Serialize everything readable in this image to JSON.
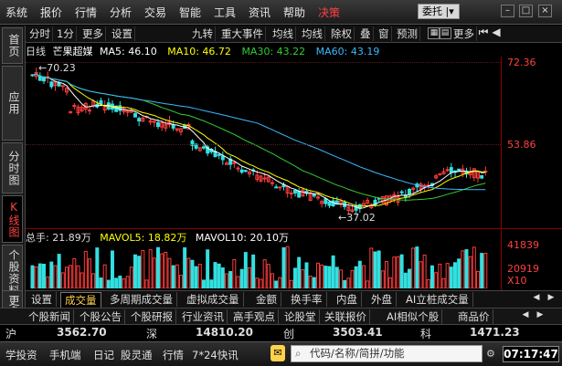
{
  "menu": {
    "items": [
      "系统",
      "报价",
      "行情",
      "分析",
      "交易",
      "智能",
      "工具",
      "资讯",
      "帮助",
      "决策"
    ],
    "active_index": 9,
    "delegate_label": "委托",
    "window_buttons": [
      "–",
      "□",
      "×"
    ]
  },
  "left_tabs": [
    "首页",
    "应用",
    "分时图",
    "K线图",
    "个股资料",
    "更多"
  ],
  "toolbar": {
    "left": [
      "分时",
      "1分",
      "更多",
      "设置"
    ],
    "right": [
      "九转",
      "重大事件",
      "均线",
      "均线",
      "除权",
      "叠",
      "窗",
      "预测",
      "更多"
    ]
  },
  "ma": {
    "period": "日线",
    "stock": "芒果超媒",
    "ma5": "MA5: 46.10",
    "ma10": "MA10: 46.72",
    "ma30": "MA30: 43.22",
    "ma60": "MA60: 43.19",
    "colors": {
      "ma5": "#ffffff",
      "ma10": "#ffff00",
      "ma30": "#33cc33",
      "ma60": "#3db8ff"
    }
  },
  "price_axis": {
    "top": "72.36",
    "mid": "53.86"
  },
  "annotations": {
    "high": "70.23",
    "low": "37.02"
  },
  "volume": {
    "total": "总手: 21.89万",
    "mavol5": "MAVOL5: 18.82万",
    "mavol10": "MAVOL10: 20.10万",
    "axis_top": "41839",
    "axis_mid": "20919",
    "axis_unit": "X10"
  },
  "bottom_tabs": [
    "设置",
    "成交量",
    "多周期成交量",
    "虚拟成交量",
    "金额",
    "换手率",
    "内盘",
    "外盘",
    "AI立桩成交量"
  ],
  "bottom_active_index": 1,
  "info_tabs": [
    "个股新闻",
    "个股公告",
    "个股研报",
    "行业资讯",
    "高手观点",
    "论股堂",
    "关联报价",
    "AI相似个股",
    "商品价"
  ],
  "indexes": [
    {
      "name": "沪",
      "value": "3562.70",
      "color": "#33ff33"
    },
    {
      "name": "深",
      "value": "14810.20",
      "color": "#ff4040"
    },
    {
      "name": "创",
      "value": "3503.41",
      "color": "#ff4040"
    },
    {
      "name": "科",
      "value": "1471.23",
      "color": "#ff4040"
    }
  ],
  "status": {
    "items": [
      "学投资",
      "手机端",
      "日记",
      "股灵通",
      "行情",
      "7*24快讯"
    ],
    "search_placeholder": "代码/名称/简拼/功能",
    "clock": "07:17:47"
  }
}
